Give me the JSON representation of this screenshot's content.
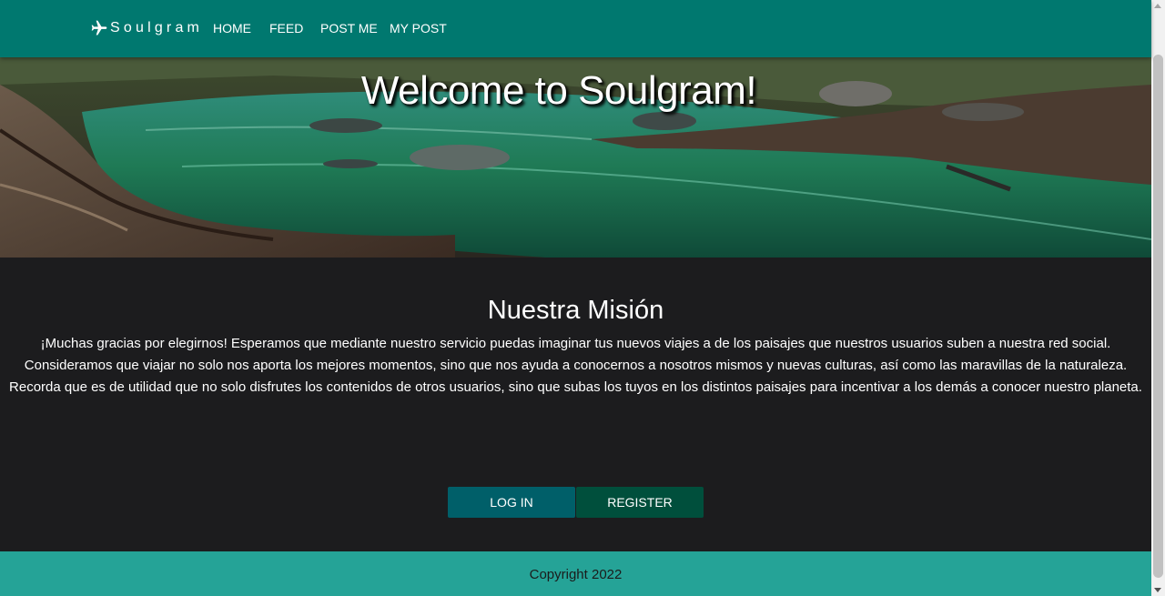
{
  "navbar": {
    "brand": "Soulgram",
    "brand_icon": "airplane-icon",
    "links": [
      "HOME",
      "FEED",
      "POST ME",
      "MY POST"
    ]
  },
  "hero": {
    "title": "Welcome to Soulgram!"
  },
  "mission": {
    "title": "Nuestra Misión",
    "text": "¡Muchas gracias por elegirnos! Esperamos que mediante nuestro servicio puedas imaginar tus nuevos viajes a de los paisajes que nuestros usuarios suben a nuestra red social. Consideramos que viajar no solo nos aporta los mejores momentos, sino que nos ayuda a conocernos a nosotros mismos y nuevas culturas, así como las maravillas de la naturaleza. Recorda que es de utilidad que no solo disfrutes los contenidos de otros usuarios, sino que subas los tuyos en los distintos paisajes para incentivar a los demás a conocer nuestro planeta."
  },
  "buttons": {
    "login": "LOG IN",
    "register": "REGISTER"
  },
  "footer": {
    "text": "Copyright 2022"
  },
  "colors": {
    "navbar": "#00786f",
    "body": "#1c1c1e",
    "login": "#005f69",
    "register": "#004f3c",
    "footer": "#25a397"
  }
}
